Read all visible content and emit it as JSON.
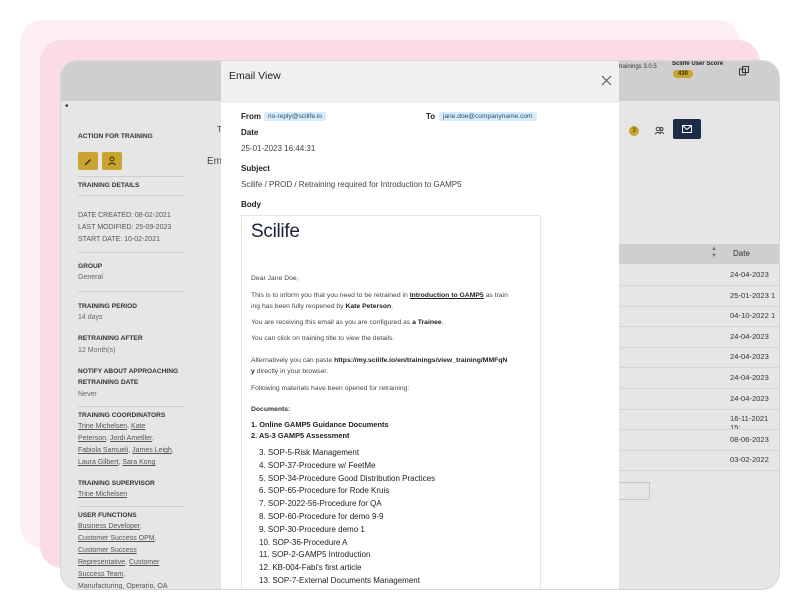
{
  "app": {
    "version": "trainings 3.0.5",
    "score_label": "Scilife User Score",
    "score_value": "430",
    "dot": "•",
    "tab_partial": "T",
    "heading_partial": "Em",
    "badge_count": "3"
  },
  "sidebar": {
    "action_title": "ACTION FOR TRAINING",
    "details_title": "TRAINING DETAILS",
    "date_created": "DATE CREATED: 08-02-2021",
    "last_modified": "LAST MODIFIED: 25-09-2023",
    "start_date": "START DATE: 10-02-2021",
    "group_title": "GROUP",
    "group_value": "General",
    "period_title": "TRAINING PERIOD",
    "period_value": "14 days",
    "retraining_title": "RETRAINING AFTER",
    "retraining_value": "12 Month(s)",
    "notify_title_1": "NOTIFY ABOUT APPROACHING",
    "notify_title_2": "RETRAINING DATE",
    "notify_value": "Never",
    "coordinators_title": "TRAINING COORDINATORS",
    "coordinators_lines": [
      [
        "Trine Michelsen",
        ", ",
        "Kate"
      ],
      [
        "Peterson",
        ", ",
        "Jordi Ametller",
        ","
      ],
      [
        "Fabiola Samueli",
        ", ",
        "James Leigh",
        ","
      ],
      [
        "Laura Gilbert",
        ", ",
        "Sara Kong"
      ]
    ],
    "supervisor_title": "TRAINING SUPERVISOR",
    "supervisor_value": "Trine Michelsen",
    "functions_title": "USER FUNCTIONS",
    "functions_lines": [
      [
        "Business Developer",
        ","
      ],
      [
        "Customer Success OPM",
        ","
      ],
      [
        "Customer Success"
      ],
      [
        "Representative",
        ", ",
        "Customer"
      ],
      [
        "Success Team",
        ","
      ],
      [
        "Manufacturing",
        ", ",
        "Operario",
        ", ",
        "OA"
      ]
    ]
  },
  "table": {
    "date_header": "Date",
    "dates": [
      "24-04-2023",
      "25-01-2023 1",
      "04-10-2022 1",
      "24-04-2023",
      "24-04-2023",
      "24-04-2023",
      "24-04-2023",
      "16-11-2021 15:",
      "08-06-2023",
      "03-02-2022"
    ]
  },
  "modal": {
    "title": "Email View",
    "from_label": "From",
    "from_value": "no-reply@scilife.io",
    "to_label": "To",
    "to_value": "jane.doe@companyname.com",
    "date_label": "Date",
    "date_value": "25-01-2023 16:44:31",
    "subject_label": "Subject",
    "subject_value": "Scilife / PROD / Retraining required for Introduction to GAMP5",
    "body_label": "Body",
    "logo_text": "Scilife",
    "greeting": "Dear Jane Doe,",
    "p1_a": "This is to inform you that you need to be retrained in ",
    "p1_link": "Introduction to GAMP5",
    "p1_b": " as train",
    "p1_c": "ing has been fully reopened by ",
    "p1_name": "Kate Peterson",
    "p1_end": ".",
    "p2_a": "You are receiving this email as you are configured as ",
    "p2_role": "a Trainee",
    "p2_end": ".",
    "p3": "You can click on training title to view the details.",
    "p4_a": "Alternatively you can paste ",
    "p4_url_1": "https://my.scilife.io/en/trainings/view_training/MMFqN",
    "p4_url_2": "y",
    "p4_b": " directly in your browser.",
    "p5": "Following materials have been opened for retraining:",
    "documents_label": "Documents:",
    "documents": [
      "1. Online GAMP5 Guidance Documents",
      "2. AS-3 GAMP5 Assessment"
    ],
    "materials": [
      "3. SOP-5-Risk Management",
      "4. SOP-37-Procedure w/ FeetMe",
      "5. SOP-34-Procedure Good Distribution Practices",
      "6. SOP-65-Procedure for Rode Kruis",
      "7. SOP-2022-56-Procedure for QA",
      "8. SOP-60-Procedure for demo 9-9",
      "9. SOP-30-Procedure demo 1",
      "10. SOP-36-Procedure A",
      "11. SOP-2-GAMP5 Introduction",
      "12. KB-004-Fabi's first article",
      "13. SOP-7-External Documents Management"
    ]
  }
}
